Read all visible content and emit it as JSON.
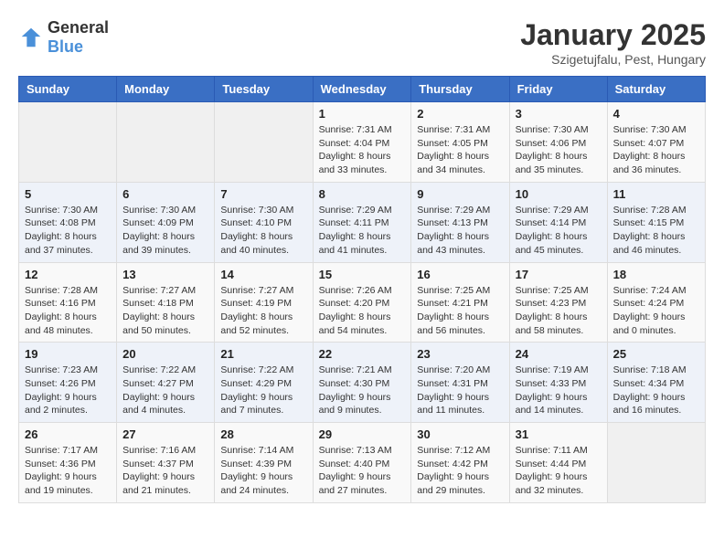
{
  "logo": {
    "general": "General",
    "blue": "Blue"
  },
  "header": {
    "month": "January 2025",
    "location": "Szigetujfalu, Pest, Hungary"
  },
  "weekdays": [
    "Sunday",
    "Monday",
    "Tuesday",
    "Wednesday",
    "Thursday",
    "Friday",
    "Saturday"
  ],
  "weeks": [
    [
      {
        "day": "",
        "sunrise": "",
        "sunset": "",
        "daylight": ""
      },
      {
        "day": "",
        "sunrise": "",
        "sunset": "",
        "daylight": ""
      },
      {
        "day": "",
        "sunrise": "",
        "sunset": "",
        "daylight": ""
      },
      {
        "day": "1",
        "sunrise": "Sunrise: 7:31 AM",
        "sunset": "Sunset: 4:04 PM",
        "daylight": "Daylight: 8 hours and 33 minutes."
      },
      {
        "day": "2",
        "sunrise": "Sunrise: 7:31 AM",
        "sunset": "Sunset: 4:05 PM",
        "daylight": "Daylight: 8 hours and 34 minutes."
      },
      {
        "day": "3",
        "sunrise": "Sunrise: 7:30 AM",
        "sunset": "Sunset: 4:06 PM",
        "daylight": "Daylight: 8 hours and 35 minutes."
      },
      {
        "day": "4",
        "sunrise": "Sunrise: 7:30 AM",
        "sunset": "Sunset: 4:07 PM",
        "daylight": "Daylight: 8 hours and 36 minutes."
      }
    ],
    [
      {
        "day": "5",
        "sunrise": "Sunrise: 7:30 AM",
        "sunset": "Sunset: 4:08 PM",
        "daylight": "Daylight: 8 hours and 37 minutes."
      },
      {
        "day": "6",
        "sunrise": "Sunrise: 7:30 AM",
        "sunset": "Sunset: 4:09 PM",
        "daylight": "Daylight: 8 hours and 39 minutes."
      },
      {
        "day": "7",
        "sunrise": "Sunrise: 7:30 AM",
        "sunset": "Sunset: 4:10 PM",
        "daylight": "Daylight: 8 hours and 40 minutes."
      },
      {
        "day": "8",
        "sunrise": "Sunrise: 7:29 AM",
        "sunset": "Sunset: 4:11 PM",
        "daylight": "Daylight: 8 hours and 41 minutes."
      },
      {
        "day": "9",
        "sunrise": "Sunrise: 7:29 AM",
        "sunset": "Sunset: 4:13 PM",
        "daylight": "Daylight: 8 hours and 43 minutes."
      },
      {
        "day": "10",
        "sunrise": "Sunrise: 7:29 AM",
        "sunset": "Sunset: 4:14 PM",
        "daylight": "Daylight: 8 hours and 45 minutes."
      },
      {
        "day": "11",
        "sunrise": "Sunrise: 7:28 AM",
        "sunset": "Sunset: 4:15 PM",
        "daylight": "Daylight: 8 hours and 46 minutes."
      }
    ],
    [
      {
        "day": "12",
        "sunrise": "Sunrise: 7:28 AM",
        "sunset": "Sunset: 4:16 PM",
        "daylight": "Daylight: 8 hours and 48 minutes."
      },
      {
        "day": "13",
        "sunrise": "Sunrise: 7:27 AM",
        "sunset": "Sunset: 4:18 PM",
        "daylight": "Daylight: 8 hours and 50 minutes."
      },
      {
        "day": "14",
        "sunrise": "Sunrise: 7:27 AM",
        "sunset": "Sunset: 4:19 PM",
        "daylight": "Daylight: 8 hours and 52 minutes."
      },
      {
        "day": "15",
        "sunrise": "Sunrise: 7:26 AM",
        "sunset": "Sunset: 4:20 PM",
        "daylight": "Daylight: 8 hours and 54 minutes."
      },
      {
        "day": "16",
        "sunrise": "Sunrise: 7:25 AM",
        "sunset": "Sunset: 4:21 PM",
        "daylight": "Daylight: 8 hours and 56 minutes."
      },
      {
        "day": "17",
        "sunrise": "Sunrise: 7:25 AM",
        "sunset": "Sunset: 4:23 PM",
        "daylight": "Daylight: 8 hours and 58 minutes."
      },
      {
        "day": "18",
        "sunrise": "Sunrise: 7:24 AM",
        "sunset": "Sunset: 4:24 PM",
        "daylight": "Daylight: 9 hours and 0 minutes."
      }
    ],
    [
      {
        "day": "19",
        "sunrise": "Sunrise: 7:23 AM",
        "sunset": "Sunset: 4:26 PM",
        "daylight": "Daylight: 9 hours and 2 minutes."
      },
      {
        "day": "20",
        "sunrise": "Sunrise: 7:22 AM",
        "sunset": "Sunset: 4:27 PM",
        "daylight": "Daylight: 9 hours and 4 minutes."
      },
      {
        "day": "21",
        "sunrise": "Sunrise: 7:22 AM",
        "sunset": "Sunset: 4:29 PM",
        "daylight": "Daylight: 9 hours and 7 minutes."
      },
      {
        "day": "22",
        "sunrise": "Sunrise: 7:21 AM",
        "sunset": "Sunset: 4:30 PM",
        "daylight": "Daylight: 9 hours and 9 minutes."
      },
      {
        "day": "23",
        "sunrise": "Sunrise: 7:20 AM",
        "sunset": "Sunset: 4:31 PM",
        "daylight": "Daylight: 9 hours and 11 minutes."
      },
      {
        "day": "24",
        "sunrise": "Sunrise: 7:19 AM",
        "sunset": "Sunset: 4:33 PM",
        "daylight": "Daylight: 9 hours and 14 minutes."
      },
      {
        "day": "25",
        "sunrise": "Sunrise: 7:18 AM",
        "sunset": "Sunset: 4:34 PM",
        "daylight": "Daylight: 9 hours and 16 minutes."
      }
    ],
    [
      {
        "day": "26",
        "sunrise": "Sunrise: 7:17 AM",
        "sunset": "Sunset: 4:36 PM",
        "daylight": "Daylight: 9 hours and 19 minutes."
      },
      {
        "day": "27",
        "sunrise": "Sunrise: 7:16 AM",
        "sunset": "Sunset: 4:37 PM",
        "daylight": "Daylight: 9 hours and 21 minutes."
      },
      {
        "day": "28",
        "sunrise": "Sunrise: 7:14 AM",
        "sunset": "Sunset: 4:39 PM",
        "daylight": "Daylight: 9 hours and 24 minutes."
      },
      {
        "day": "29",
        "sunrise": "Sunrise: 7:13 AM",
        "sunset": "Sunset: 4:40 PM",
        "daylight": "Daylight: 9 hours and 27 minutes."
      },
      {
        "day": "30",
        "sunrise": "Sunrise: 7:12 AM",
        "sunset": "Sunset: 4:42 PM",
        "daylight": "Daylight: 9 hours and 29 minutes."
      },
      {
        "day": "31",
        "sunrise": "Sunrise: 7:11 AM",
        "sunset": "Sunset: 4:44 PM",
        "daylight": "Daylight: 9 hours and 32 minutes."
      },
      {
        "day": "",
        "sunrise": "",
        "sunset": "",
        "daylight": ""
      }
    ]
  ]
}
